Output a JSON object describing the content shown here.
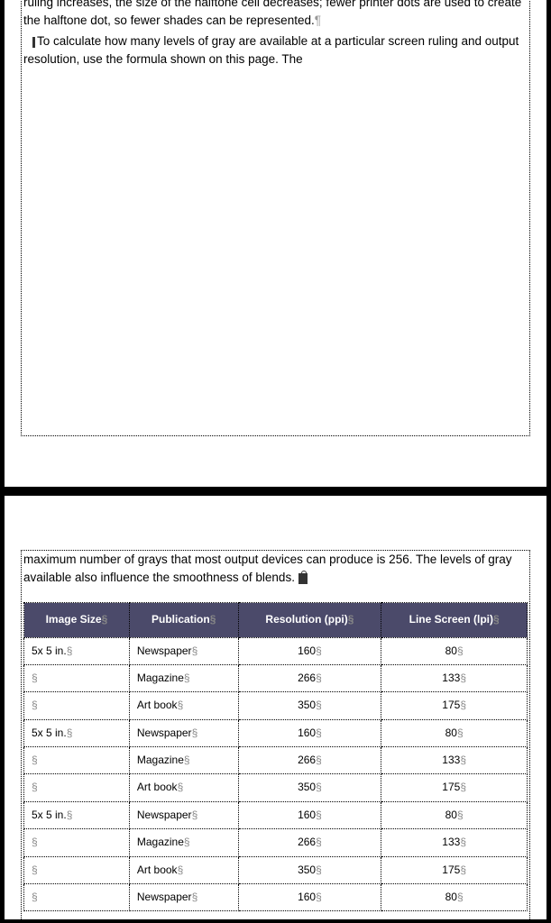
{
  "page1": {
    "p1": "ruling increases, the size of the halftone cell decreases; fewer printer dots are used to create the halftone dot, so fewer shades can be represented.",
    "p2": "To calculate how many levels of gray are available at a particular screen ruling and output resolution, use the formula shown on this page. The"
  },
  "page2": {
    "p1": "maximum number of grays that most output devices can produce is 256. The levels of gray available also influence the smoothness of blends."
  },
  "table": {
    "headers": {
      "h1": "Image Size",
      "h2": "Publication",
      "h3": "Resolution (ppi)",
      "h4": "Line Screen (lpi)"
    },
    "rows": [
      {
        "size": "5x 5 in.",
        "pub": "Newspaper",
        "res": "160",
        "lpi": "80"
      },
      {
        "size": "",
        "pub": "Magazine",
        "res": "266",
        "lpi": "133"
      },
      {
        "size": "",
        "pub": "Art book",
        "res": "350",
        "lpi": "175"
      },
      {
        "size": "5x 5 in.",
        "pub": "Newspaper",
        "res": "160",
        "lpi": "80"
      },
      {
        "size": "",
        "pub": "Magazine",
        "res": "266",
        "lpi": "133"
      },
      {
        "size": "",
        "pub": "Art book",
        "res": "350",
        "lpi": "175"
      },
      {
        "size": "5x 5 in.",
        "pub": "Newspaper",
        "res": "160",
        "lpi": "80"
      },
      {
        "size": "",
        "pub": "Magazine",
        "res": "266",
        "lpi": "133"
      },
      {
        "size": "",
        "pub": "Art book",
        "res": "350",
        "lpi": "175"
      },
      {
        "size": "",
        "pub": "Newspaper",
        "res": "160",
        "lpi": "80"
      }
    ]
  },
  "glyphs": {
    "pilcrow": "¶",
    "section": "§"
  }
}
